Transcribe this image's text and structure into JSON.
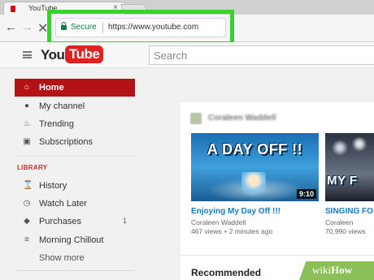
{
  "browser": {
    "tab_title": "YouTube",
    "secure_label": "Secure",
    "url": "https://www.youtube.com"
  },
  "header": {
    "logo_you": "You",
    "logo_tube": "Tube",
    "search_placeholder": "Search"
  },
  "sidebar": {
    "items": [
      {
        "label": "Home",
        "icon": "home-icon",
        "active": true
      },
      {
        "label": "My channel",
        "icon": "account-icon"
      },
      {
        "label": "Trending",
        "icon": "flame-icon"
      },
      {
        "label": "Subscriptions",
        "icon": "subscriptions-icon"
      }
    ],
    "library_title": "LIBRARY",
    "library": [
      {
        "label": "History",
        "icon": "hourglass-icon"
      },
      {
        "label": "Watch Later",
        "icon": "clock-icon"
      },
      {
        "label": "Purchases",
        "icon": "tag-icon",
        "count": "1"
      },
      {
        "label": "Morning Chillout",
        "icon": "playlist-icon"
      }
    ],
    "show_more": "Show more"
  },
  "feed": {
    "channel_name": "Coraleen Waddell",
    "videos": [
      {
        "thumb_caption": "A DAY OFF !!",
        "duration": "9:10",
        "title": "Enjoying My Day Off !!!",
        "channel": "Coraleen Waddell",
        "views": "467 views",
        "age": "2 minutes ago"
      },
      {
        "thumb_caption": "MY F",
        "title": "SINGING FO",
        "channel": "Coraleen",
        "views": "70,990 views"
      }
    ],
    "recommended_title": "Recommended"
  },
  "watermark": {
    "wiki": "wiki",
    "how": "How"
  },
  "colors": {
    "omnibox_highlight": "#35d42a",
    "youtube_red": "#e02121",
    "active_nav": "#b31217",
    "link_blue": "#167ac6",
    "secure_green": "#0b8043"
  }
}
